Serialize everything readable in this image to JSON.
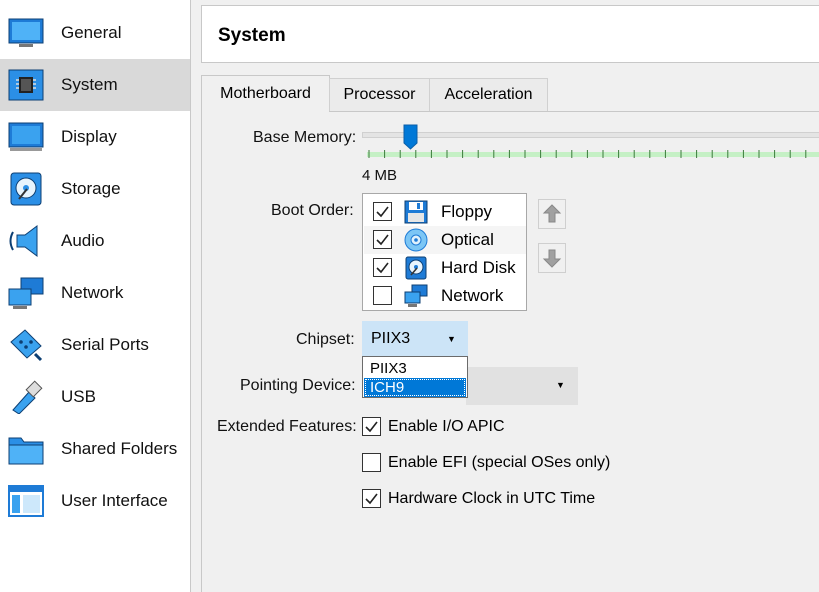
{
  "sidebar": {
    "items": [
      {
        "label": "General",
        "icon": "general-icon"
      },
      {
        "label": "System",
        "icon": "system-icon",
        "selected": true
      },
      {
        "label": "Display",
        "icon": "display-icon"
      },
      {
        "label": "Storage",
        "icon": "storage-icon"
      },
      {
        "label": "Audio",
        "icon": "audio-icon"
      },
      {
        "label": "Network",
        "icon": "network-icon"
      },
      {
        "label": "Serial Ports",
        "icon": "serial-ports-icon"
      },
      {
        "label": "USB",
        "icon": "usb-icon"
      },
      {
        "label": "Shared Folders",
        "icon": "shared-folders-icon"
      },
      {
        "label": "User Interface",
        "icon": "user-interface-icon"
      }
    ]
  },
  "header": {
    "title": "System"
  },
  "tabs": [
    {
      "label": "Motherboard",
      "active": true
    },
    {
      "label": "Processor"
    },
    {
      "label": "Acceleration"
    }
  ],
  "motherboard": {
    "base_memory_label": "Base Memory:",
    "base_memory_value": "4 MB",
    "boot_order_label": "Boot Order:",
    "boot_items": [
      {
        "label": "Floppy",
        "checked": true,
        "icon": "floppy-icon"
      },
      {
        "label": "Optical",
        "checked": true,
        "icon": "optical-disc-icon"
      },
      {
        "label": "Hard Disk",
        "checked": true,
        "icon": "hard-disk-icon"
      },
      {
        "label": "Network",
        "checked": false,
        "icon": "network-icon"
      }
    ],
    "chipset_label": "Chipset:",
    "chipset_value": "PIIX3",
    "chipset_options": [
      "PIIX3",
      "ICH9"
    ],
    "chipset_highlighted": "ICH9",
    "pointing_device_label": "Pointing Device:",
    "extended_features_label": "Extended Features:",
    "features": [
      {
        "label": "Enable I/O APIC",
        "checked": true
      },
      {
        "label": "Enable EFI (special OSes only)",
        "checked": false
      },
      {
        "label": "Hardware Clock in UTC Time",
        "checked": true
      }
    ]
  },
  "colors": {
    "selection_blue": "#0078d7",
    "combo_hover": "#cce4f7",
    "slider_green": "#c5f0c5"
  }
}
